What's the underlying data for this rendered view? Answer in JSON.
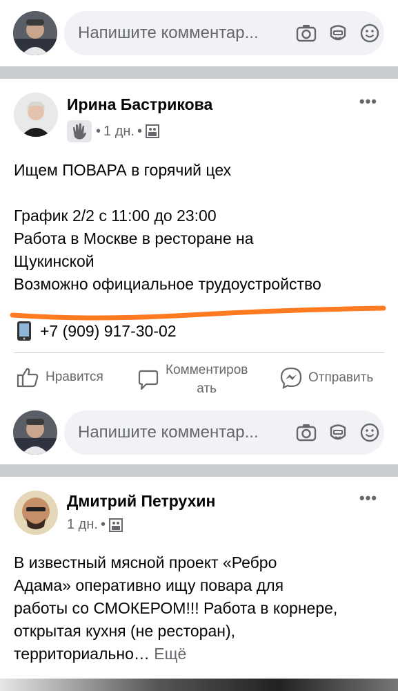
{
  "comment_box": {
    "placeholder": "Напишите комментар..."
  },
  "posts": [
    {
      "author": "Ирина Бастрикова",
      "time": "1 дн.",
      "lines": [
        "Ищем ПОВАРА в горячий цех",
        "",
        "График 2/2 с 11:00 до 23:00",
        "Работа в Москве в ресторане на",
        "Щукинской",
        "Возможно официальное трудоустройство"
      ],
      "phone": "+7 (909) 917-30-02",
      "annotation_color": "#ff7a21"
    },
    {
      "author": "Дмитрий Петрухин",
      "time": "1 дн.",
      "lines": [
        "В известный мясной проект «Ребро",
        "Адама» оперативно ищу повара для",
        "работы со СМОКЕРОМ!!! Работа в корнере,",
        "открытая кухня (не ресторан),",
        "территориально…"
      ],
      "see_more": "Ещё"
    }
  ],
  "actions": {
    "like": "Нравится",
    "comment_line1": "Комментиров",
    "comment_line2": "ать",
    "share": "Отправить"
  },
  "more_glyph": "•••"
}
